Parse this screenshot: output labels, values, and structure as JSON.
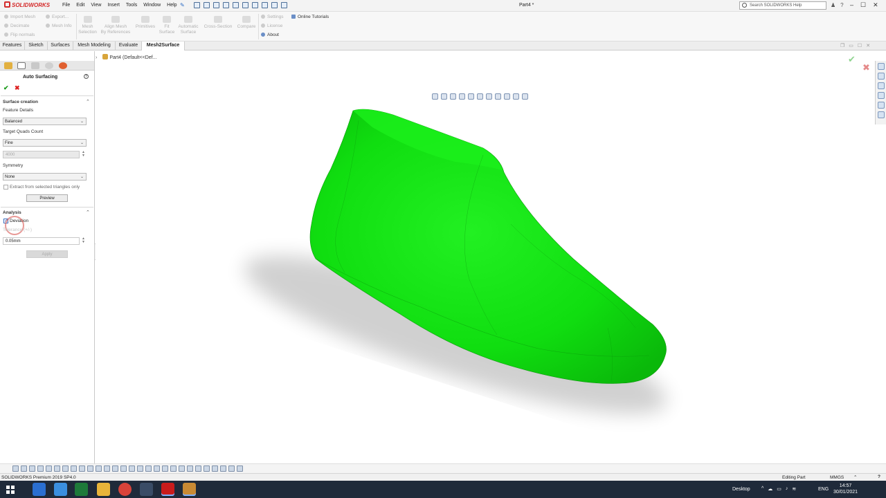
{
  "app": {
    "logo_text": "SOLIDWORKS",
    "document_title": "Part4 *",
    "search_placeholder": "Search SOLIDWORKS Help"
  },
  "menu": [
    "File",
    "Edit",
    "View",
    "Insert",
    "Tools",
    "Window",
    "Help"
  ],
  "ribbon": {
    "small_left": [
      "Import Mesh",
      "Decimate",
      "Flip normals"
    ],
    "small_left2": [
      "Export...",
      "Mesh Info"
    ],
    "big": [
      {
        "l1": "Mesh",
        "l2": "Selection"
      },
      {
        "l1": "Align Mesh",
        "l2": "By References"
      },
      {
        "l1": "Primitives",
        "l2": ""
      },
      {
        "l1": "Fit",
        "l2": "Surface"
      },
      {
        "l1": "Automatic",
        "l2": "Surface"
      },
      {
        "l1": "Cross-Section",
        "l2": ""
      },
      {
        "l1": "Compare",
        "l2": ""
      }
    ],
    "small_right": [
      "Settings",
      "License",
      "About"
    ],
    "online_tutorials": "Online Tutorials"
  },
  "tabs": [
    "Features",
    "Sketch",
    "Surfaces",
    "Mesh Modeling",
    "Evaluate",
    "Mesh2Surface"
  ],
  "active_tab": "Mesh2Surface",
  "panel": {
    "title": "Auto Surfacing",
    "section_surface": "Surface creation",
    "feature_details_label": "Feature Details",
    "feature_details_value": "Balanced",
    "target_quads_label": "Target Quads Count",
    "target_quads_value": "Fine",
    "quads_number": "4000",
    "symmetry_label": "Symmetry",
    "symmetry_value": "None",
    "extract_label": "Extract from selected triangles only",
    "preview_button": "Preview",
    "section_analysis": "Analysis",
    "deviation_label": "Deviation",
    "deviation_hint": "Tolerance (+/-)",
    "deviation_value": "0.05mm",
    "apply_button": "Apply"
  },
  "viewport": {
    "tree_label": "Part4  (Default<<Def...",
    "model_color": "#16e016",
    "model_name": "shoe-last-model"
  },
  "status": {
    "left": "SOLIDWORKS Premium 2019 SP4.0",
    "mode": "Editing Part",
    "units": "MMGS"
  },
  "taskbar": {
    "desktop": "Desktop",
    "language": "ENG",
    "time": "14:57",
    "date": "30/01/2021"
  }
}
